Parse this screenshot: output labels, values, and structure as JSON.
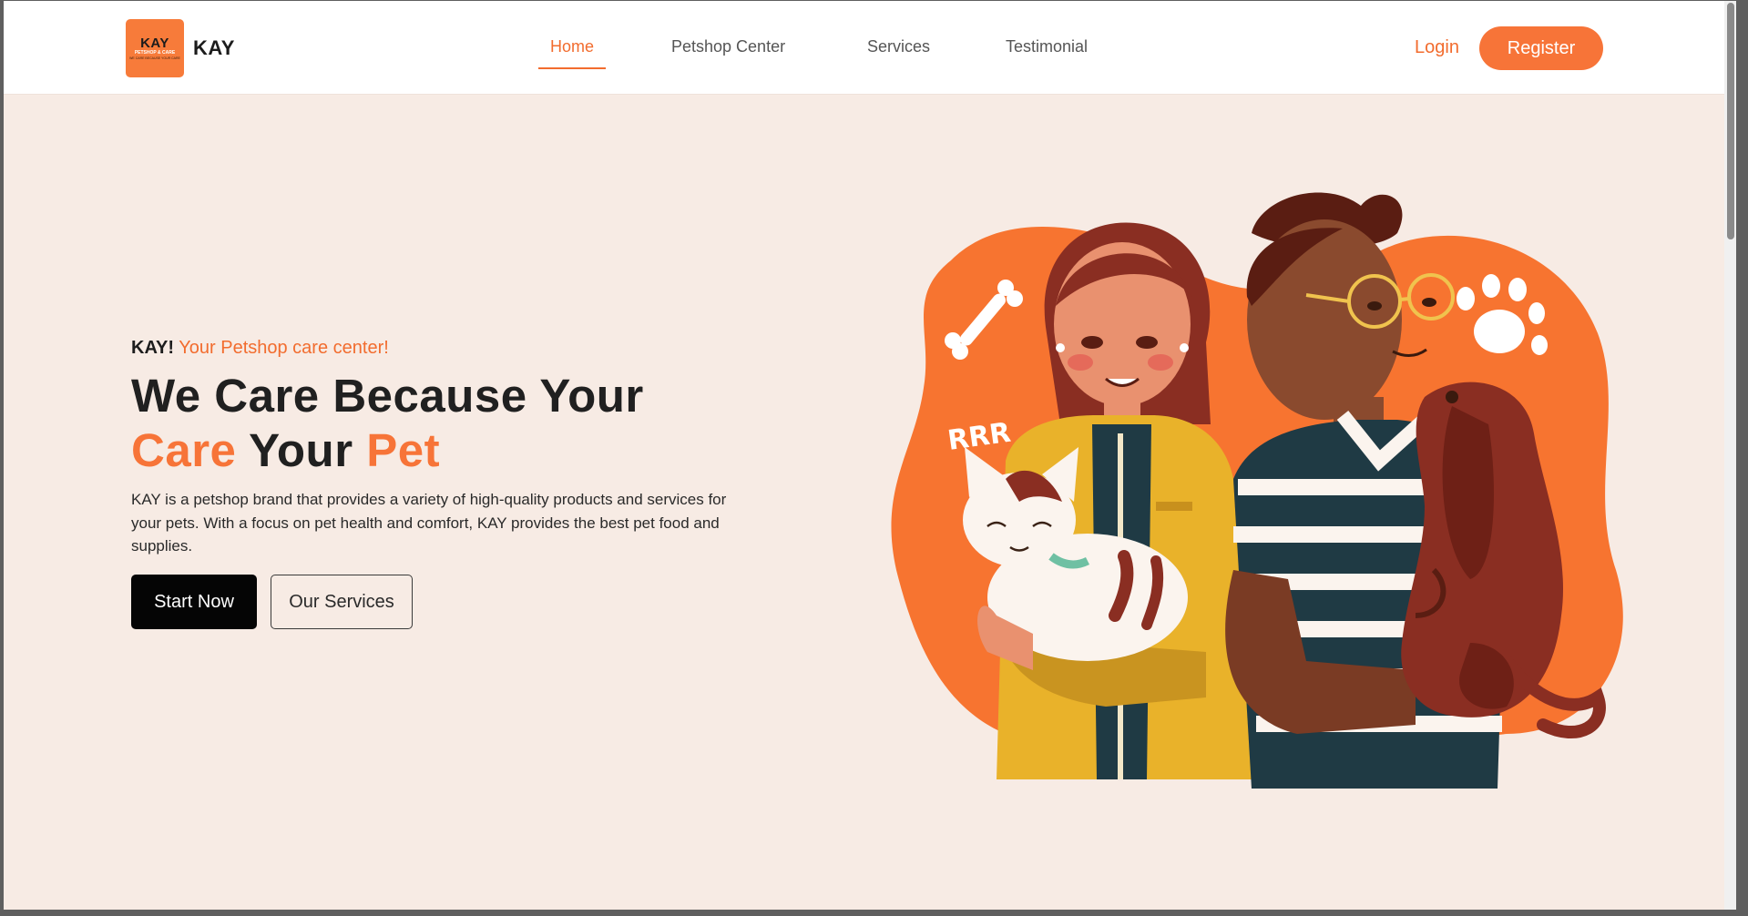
{
  "brand": {
    "logo_main": "KAY",
    "logo_sub": "PETSHOP & CARE",
    "logo_tiny": "WE CARE BECAUSE YOUR CARE",
    "name": "KAY"
  },
  "nav": {
    "items": [
      {
        "label": "Home",
        "active": true
      },
      {
        "label": "Petshop Center",
        "active": false
      },
      {
        "label": "Services",
        "active": false
      },
      {
        "label": "Testimonial",
        "active": false
      }
    ],
    "login_label": "Login",
    "register_label": "Register"
  },
  "hero": {
    "tagline_brand": "KAY!",
    "tagline_text": "Your Petshop care center!",
    "headline_line1": "We Care Because Your",
    "headline_care": "Care",
    "headline_your": "Your",
    "headline_pet": "Pet",
    "description": "KAY is a petshop brand that provides a variety of high-quality products and services for your pets. With a focus on pet health and comfort, KAY provides the best pet food and supplies.",
    "primary_button": "Start Now",
    "secondary_button": "Our Services",
    "illustration_sound": "RRR"
  },
  "colors": {
    "accent": "#f77438",
    "background": "#f7ebe4",
    "dark": "#050505"
  }
}
